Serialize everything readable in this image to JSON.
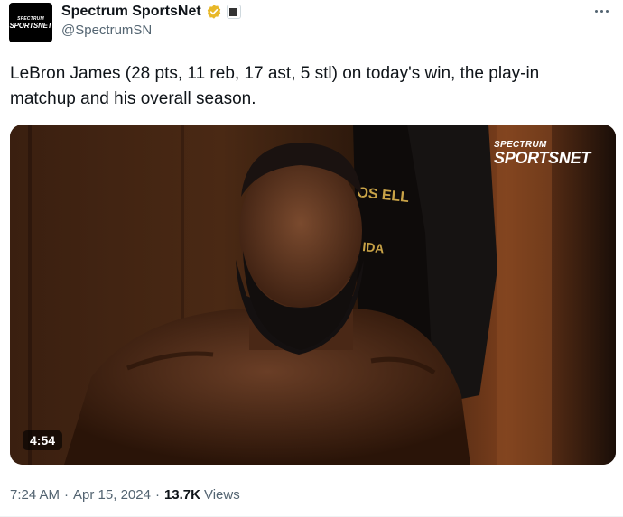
{
  "account": {
    "display_name": "Spectrum SportsNet",
    "handle": "@SpectrumSN",
    "avatar_text_top": "SPECTRUM",
    "avatar_text_bottom": "SPORTSNET",
    "verified_color": "#e8b829"
  },
  "tweet": {
    "text": "LeBron James (28 pts, 11 reb, 17 ast, 5 stl) on today's win, the play-in matchup and his overall season."
  },
  "video": {
    "watermark_top": "SPECTRUM",
    "watermark_bottom": "SPORTSNET",
    "duration": "4:54"
  },
  "meta": {
    "time": "7:24 AM",
    "separator": "·",
    "date": "Apr 15, 2024",
    "views_count": "13.7K",
    "views_label": "Views"
  },
  "icons": {
    "more": "more-icon",
    "verified": "verified-badge-icon",
    "affiliation": "affiliation-badge-icon"
  },
  "colors": {
    "text_primary": "#0f1419",
    "text_secondary": "#536471",
    "video_bg": "#2a160c"
  }
}
